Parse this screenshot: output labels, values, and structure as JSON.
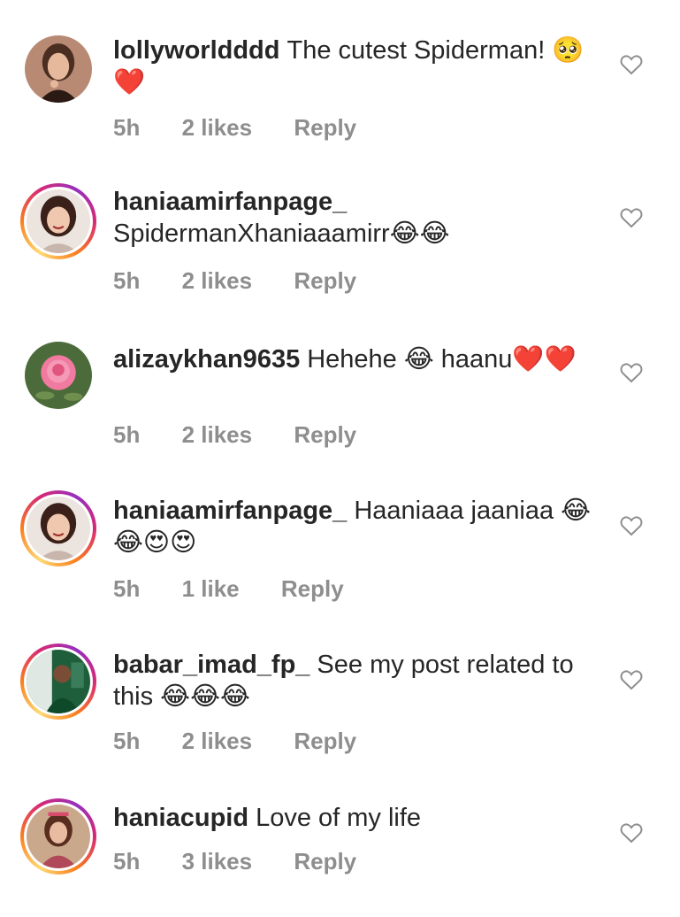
{
  "comments": [
    {
      "username": "lollyworldddd",
      "text": "The cutest Spiderman! 🥺❤️",
      "time": "5h",
      "likes": "2 likes",
      "reply": "Reply",
      "story_ring": false,
      "avatar_icon": "woman-portrait"
    },
    {
      "username": "haniaamirfanpage_",
      "text": "SpidermanXhaniaaamirr😂😂",
      "time": "5h",
      "likes": "2 likes",
      "reply": "Reply",
      "story_ring": true,
      "avatar_icon": "smiling-woman-portrait"
    },
    {
      "username": "alizaykhan9635",
      "text": "Hehehe 😂 haanu❤️❤️",
      "time": "5h",
      "likes": "2 likes",
      "reply": "Reply",
      "story_ring": false,
      "avatar_icon": "pink-rose"
    },
    {
      "username": "haniaamirfanpage_",
      "text": "Haaniaaa jaaniaa 😂😂😍😍",
      "time": "5h",
      "likes": "1 like",
      "reply": "Reply",
      "story_ring": true,
      "avatar_icon": "smiling-woman-portrait"
    },
    {
      "username": "babar_imad_fp_",
      "text": "See my post related to this 😂😂😂",
      "time": "5h",
      "likes": "2 likes",
      "reply": "Reply",
      "story_ring": true,
      "avatar_icon": "cricket-player"
    },
    {
      "username": "haniacupid",
      "text": "Love of my life",
      "time": "5h",
      "likes": "3 likes",
      "reply": "Reply",
      "story_ring": true,
      "avatar_icon": "woman-portrait-outdoor"
    }
  ],
  "colors": {
    "text": "#262626",
    "meta": "#8e8e8e",
    "heart": "#8e8e8e"
  }
}
